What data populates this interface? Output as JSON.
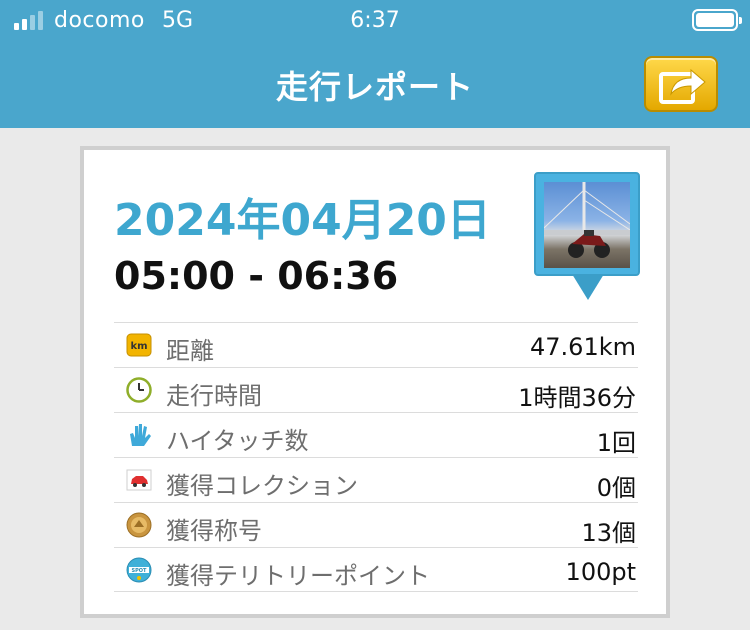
{
  "status_bar": {
    "carrier": "docomo",
    "network": "5G",
    "time": "6:37"
  },
  "nav": {
    "title": "走行レポート",
    "share_icon": "share-arrow-icon"
  },
  "report": {
    "date": "2024年04月20日",
    "time_range": "05:00 - 06:36",
    "photo_icon": "photo-map-pin-icon",
    "stats": [
      {
        "icon": "km-icon",
        "label": "距離",
        "value": "47.61km"
      },
      {
        "icon": "clock-icon",
        "label": "走行時間",
        "value": "1時間36分"
      },
      {
        "icon": "high-five-hand-icon",
        "label": "ハイタッチ数",
        "value": "1回"
      },
      {
        "icon": "car-collection-icon",
        "label": "獲得コレクション",
        "value": "0個"
      },
      {
        "icon": "title-medal-icon",
        "label": "獲得称号",
        "value": "13個"
      },
      {
        "icon": "spot-icon",
        "label": "獲得テリトリーポイント",
        "value": "100pt"
      }
    ]
  },
  "colors": {
    "header_bg": "#4aa6cc",
    "date_accent": "#3ea7cf",
    "share_button": "#f0b800",
    "page_bg": "#eaeaea"
  }
}
